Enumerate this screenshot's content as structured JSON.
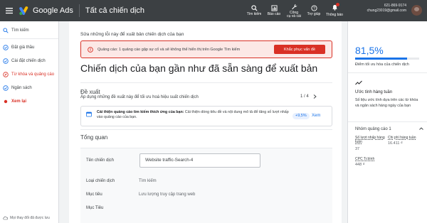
{
  "header": {
    "app_name": "Google Ads",
    "page_title": "Tất cả chiến dịch",
    "tools": [
      {
        "label1": "Tìm kiếm",
        "label2": ""
      },
      {
        "label1": "Báo cáo",
        "label2": ""
      },
      {
        "label1": "Công",
        "label2": "cụ và cài"
      },
      {
        "label1": "Trợ giúp",
        "label2": ""
      },
      {
        "label1": "Thông báo",
        "label2": ""
      }
    ],
    "account_id": "621-869-9174",
    "account_email": "chung23019@gmail.com"
  },
  "sidebar": {
    "items": [
      {
        "label": "Tìm kiếm",
        "icon": "search-icon"
      },
      {
        "label": "Đặt giá thầu",
        "icon": "check-circle-icon"
      },
      {
        "label": "Cài đặt chiến dịch",
        "icon": "check-circle-icon"
      },
      {
        "label": "Từ khóa và quảng cáo",
        "icon": "edit-icon"
      },
      {
        "label": "Ngân sách",
        "icon": "check-circle-icon"
      },
      {
        "label": "Xem lại",
        "icon": "dot-icon"
      }
    ],
    "footer": "Mọi thay đổi đã được lưu"
  },
  "main": {
    "error_title": "Sửa những lỗi này để xuất bản chiến dịch của bạn",
    "error_message": "Quảng cáo: 1 quảng cáo gặp sự cố và sẽ không thể hiển thị trên Google Tìm kiếm",
    "fix_button": "Khắc phục vấn đề",
    "hero_title": "Chiến dịch của bạn gần như đã sẵn sàng để xuất bản",
    "suggestions_title": "Đề xuất",
    "suggestions_sub": "Áp dụng những đề xuất này để tối ưu hoá hiệu suất chiến dịch",
    "pager": "1 / 4",
    "suggestion": {
      "bold": "Cải thiện quảng cáo tìm kiếm thích ứng của bạn:",
      "text": " Cải thiện dòng tiêu đề và nội dung mô tả để tăng số lượt nhấp vào quảng cáo của bạn.",
      "uplift": "+9,5%",
      "link": "Xem"
    },
    "overview_title": "Tổng quan",
    "form": {
      "name_label": "Tên chiến dịch",
      "name_value": "Website traffic-Search-4",
      "type_label": "Loại chiến dịch",
      "type_value": "Tìm kiếm",
      "goal_label": "Mục tiêu",
      "goal_value": "Lưu lượng truy cập trang web",
      "goal2_label": "Mục Tiêu"
    }
  },
  "right_panel": {
    "score": "81,5%",
    "score_fraction": 0.815,
    "score_label": "Điểm tối ưu hóa của chiến dịch",
    "trend_title": "Ước tính hàng tuần",
    "trend_desc": "Số liệu ước tính dựa trên các từ khóa và ngân sách hàng ngày của bạn",
    "group_title": "Nhóm quảng cáo 1",
    "metrics": [
      {
        "label": "Số lượt nhấp hàng tuần",
        "value": "37"
      },
      {
        "label": "Chi phí hàng tuần",
        "value": "16.411 ₫"
      },
      {
        "label": "CPC Tr.bình",
        "value": "448 ₫"
      }
    ]
  },
  "colors": {
    "accent": "#1a73e8",
    "error": "#d93025",
    "topbar": "#3c4043"
  }
}
